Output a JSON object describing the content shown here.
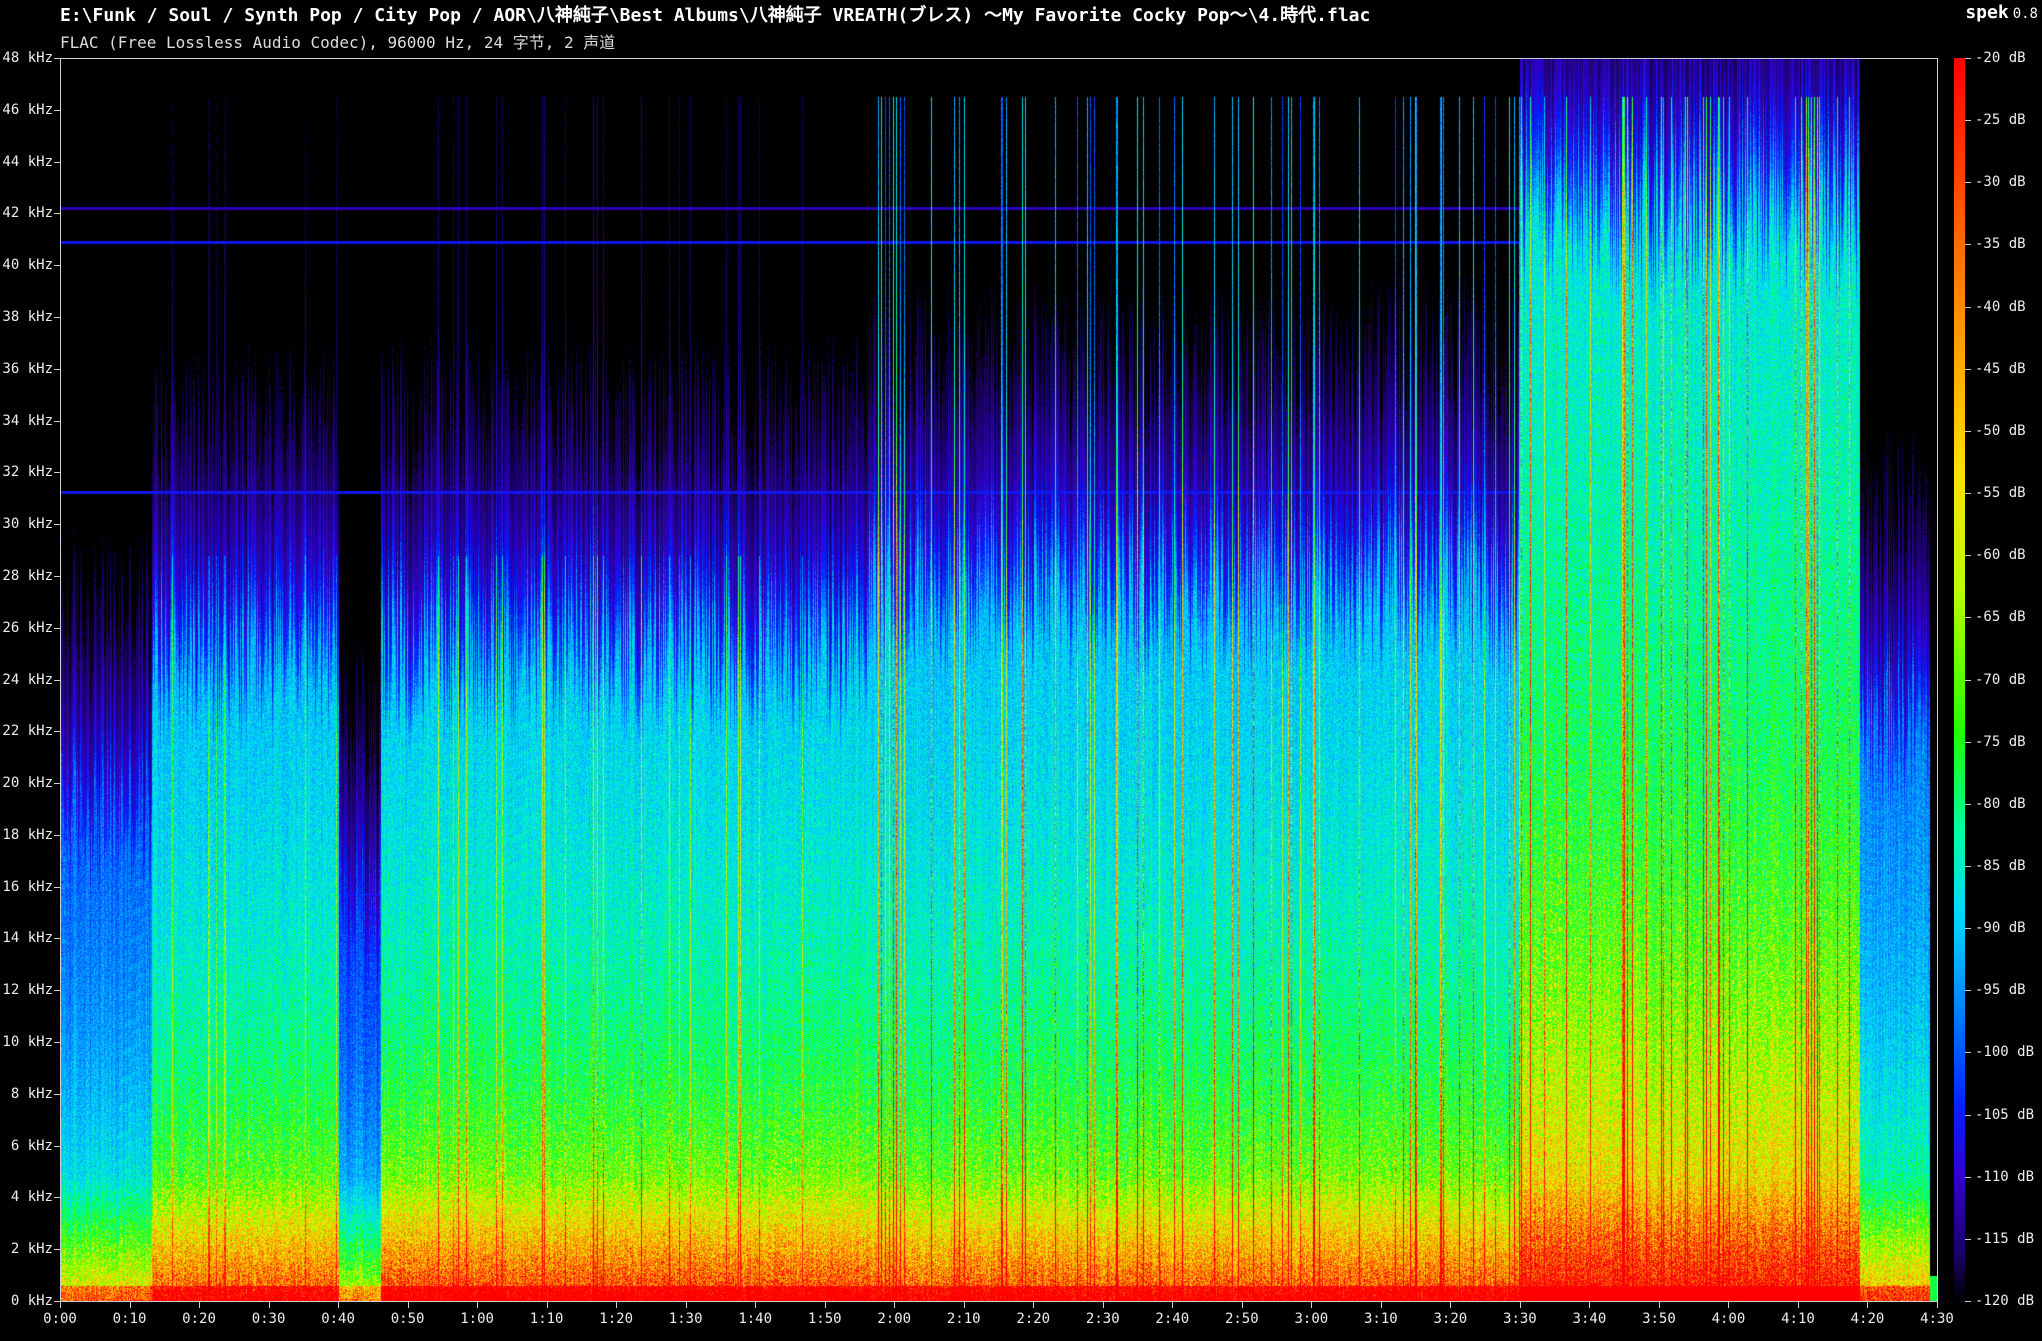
{
  "header": {
    "file_path": "E:\\Funk / Soul / Synth Pop / City Pop / AOR\\八神純子\\Best Albums\\八神純子 VREATH(ブレス) ～My Favorite Cocky Pop～\\4.時代.flac",
    "file_info": "FLAC (Free Lossless Audio Codec), 96000 Hz, 24 字节, 2 声道",
    "app_name": "spek",
    "app_version": "0.8"
  },
  "chart_data": {
    "type": "heatmap",
    "title": "",
    "x_axis": {
      "label": "",
      "range_seconds": [
        0,
        270
      ],
      "tick_labels": [
        "0:00",
        "0:10",
        "0:20",
        "0:30",
        "0:40",
        "0:50",
        "1:00",
        "1:10",
        "1:20",
        "1:30",
        "1:40",
        "1:50",
        "2:00",
        "2:10",
        "2:20",
        "2:30",
        "2:40",
        "2:50",
        "3:00",
        "3:10",
        "3:20",
        "3:30",
        "3:40",
        "3:50",
        "4:00",
        "4:10",
        "4:20",
        "4:30"
      ]
    },
    "y_axis": {
      "label": "",
      "range_khz": [
        0,
        48
      ],
      "tick_labels": [
        "0 kHz",
        "2 kHz",
        "4 kHz",
        "6 kHz",
        "8 kHz",
        "10 kHz",
        "12 kHz",
        "14 kHz",
        "16 kHz",
        "18 kHz",
        "20 kHz",
        "22 kHz",
        "24 kHz",
        "26 kHz",
        "28 kHz",
        "30 kHz",
        "32 kHz",
        "34 kHz",
        "36 kHz",
        "38 kHz",
        "40 kHz",
        "42 kHz",
        "44 kHz",
        "46 kHz",
        "48 kHz"
      ]
    },
    "colorbar": {
      "range_db": [
        -120,
        -20
      ],
      "tick_labels": [
        "-20 dB",
        "-25 dB",
        "-30 dB",
        "-35 dB",
        "-40 dB",
        "-45 dB",
        "-50 dB",
        "-55 dB",
        "-60 dB",
        "-65 dB",
        "-70 dB",
        "-75 dB",
        "-80 dB",
        "-85 dB",
        "-90 dB",
        "-95 dB",
        "-100 dB",
        "-105 dB",
        "-110 dB",
        "-115 dB",
        "-120 dB"
      ]
    },
    "colors": {
      "background": "#000000",
      "axis": "#cfcfcf",
      "scale": [
        "#000000",
        "#1a0068",
        "#3200d0",
        "#0022ff",
        "#0088ff",
        "#00d8ff",
        "#00ffa0",
        "#22ff00",
        "#b8ff00",
        "#ffe000",
        "#ff9900",
        "#ff5500",
        "#ff0000"
      ]
    }
  }
}
